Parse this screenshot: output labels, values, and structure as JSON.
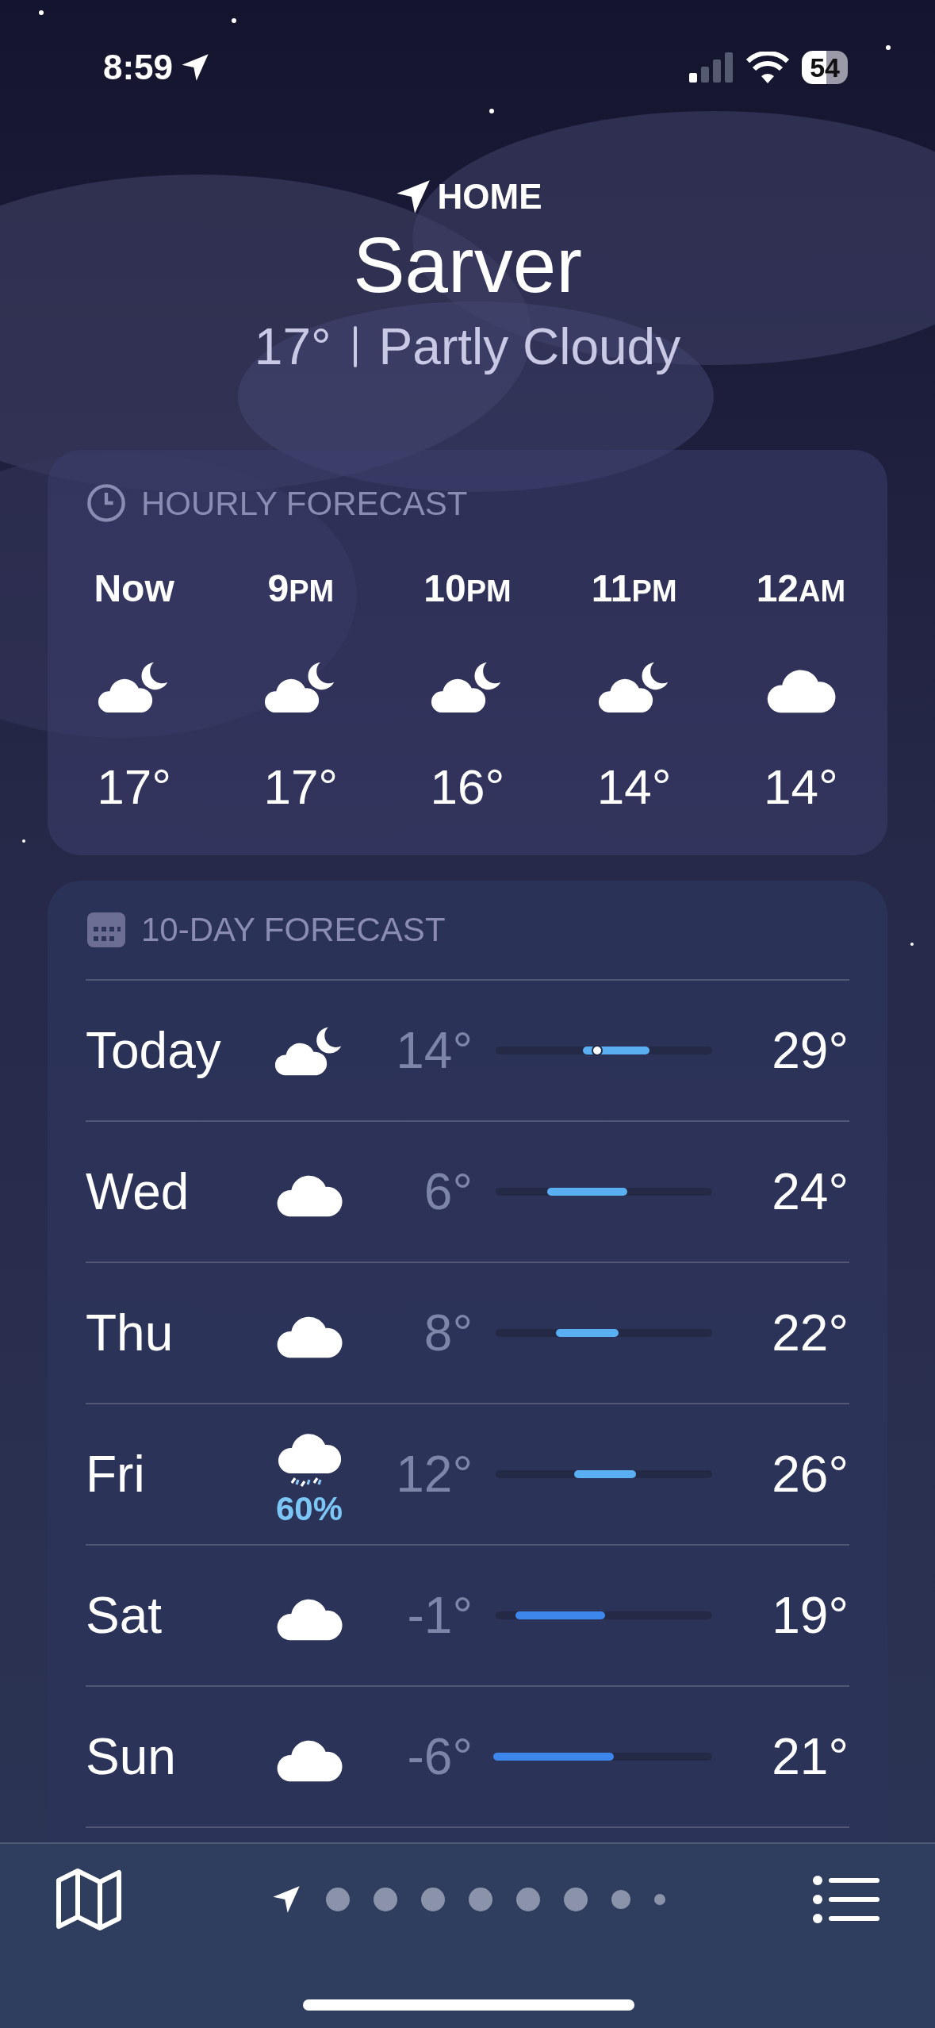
{
  "status_bar": {
    "time": "8:59",
    "battery": "54"
  },
  "header": {
    "label": "HOME",
    "city": "Sarver",
    "temperature": "17°",
    "condition": "Partly Cloudy"
  },
  "hourly": {
    "title": "HOURLY FORECAST",
    "hours": [
      {
        "hour": "Now",
        "kind": "partly-cloudy-night",
        "temp": "17°"
      },
      {
        "hour": "9",
        "suffix": "PM",
        "kind": "partly-cloudy-night",
        "temp": "17°"
      },
      {
        "hour": "10",
        "suffix": "PM",
        "kind": "partly-cloudy-night",
        "temp": "16°"
      },
      {
        "hour": "11",
        "suffix": "PM",
        "kind": "partly-cloudy-night",
        "temp": "14°"
      },
      {
        "hour": "12",
        "suffix": "AM",
        "kind": "cloudy",
        "temp": "14°"
      }
    ]
  },
  "daily": {
    "title": "10-DAY FORECAST",
    "days": [
      {
        "day": "Today",
        "kind": "partly-cloudy-night",
        "low": "14°",
        "high": "29°",
        "color": "#5aaef2",
        "current": {
          "level": 0.47
        }
      },
      {
        "day": "Wed",
        "kind": "cloudy",
        "low": "6°",
        "high": "24°",
        "color": "#5aaef2"
      },
      {
        "day": "Thu",
        "kind": "cloudy",
        "low": "8°",
        "high": "22°",
        "color": "#5aaef2"
      },
      {
        "day": "Fri",
        "kind": "snow",
        "precipitation": "60%",
        "low": "12°",
        "high": "26°",
        "color": "#5aaef2"
      },
      {
        "day": "Sat",
        "kind": "cloudy",
        "low": "-1°",
        "high": "19°",
        "color": "#3d86ec"
      },
      {
        "day": "Sun",
        "kind": "cloudy",
        "low": "-6°",
        "high": "21°",
        "color": "#3d86ec"
      }
    ]
  },
  "pages": [
    {
      "kind": "location",
      "selected": true
    },
    {
      "kind": "dot",
      "selected": false
    },
    {
      "kind": "dot",
      "selected": false
    },
    {
      "kind": "dot",
      "selected": false
    },
    {
      "kind": "dot",
      "selected": false
    },
    {
      "kind": "dot",
      "selected": false
    },
    {
      "kind": "dot",
      "selected": false
    },
    {
      "kind": "dot-small",
      "selected": false
    },
    {
      "kind": "dot-tiny",
      "selected": false
    }
  ]
}
